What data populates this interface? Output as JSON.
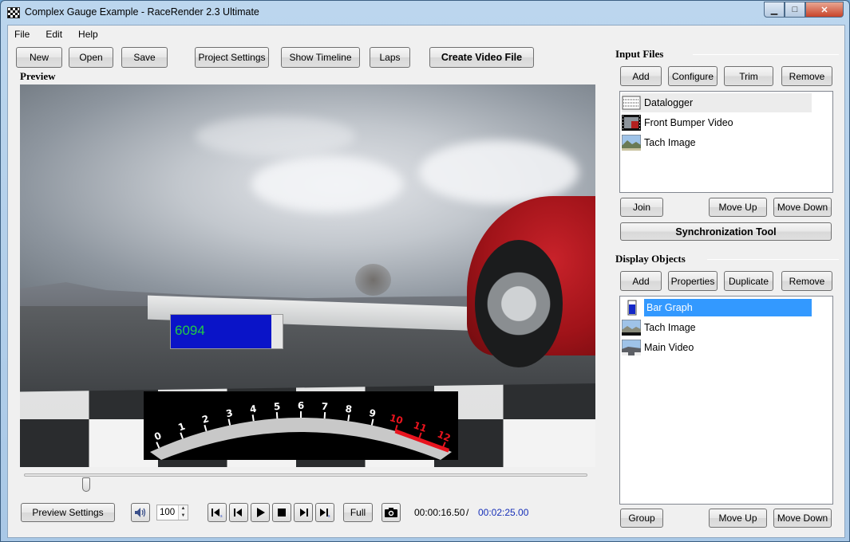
{
  "window": {
    "title": "Complex Gauge Example - RaceRender 2.3 Ultimate",
    "minimize_glyph": "▁",
    "maximize_glyph": "□",
    "close_glyph": "✕"
  },
  "menu": [
    "File",
    "Edit",
    "Help"
  ],
  "toolbar": {
    "new": "New",
    "open": "Open",
    "save": "Save",
    "project_settings": "Project Settings",
    "show_timeline": "Show Timeline",
    "laps": "Laps",
    "create_video": "Create Video File"
  },
  "preview": {
    "label": "Preview",
    "bar_graph_value": "6094",
    "bar_graph_fill_fraction": 0.9,
    "tach_labels": [
      "0",
      "1",
      "2",
      "3",
      "4",
      "5",
      "6",
      "7",
      "8",
      "9",
      "10",
      "11",
      "12"
    ],
    "tach_redline_from": 10,
    "colors": {
      "bar_fill": "#0a14c8",
      "bar_text": "#22cc44",
      "redline": "#e8141e"
    }
  },
  "playback": {
    "preview_settings": "Preview Settings",
    "volume_icon": "speaker-icon",
    "volume_value": "100",
    "full": "Full",
    "current_time": "00:00:16.50",
    "separator": "/",
    "total_time": "00:02:25.00",
    "seek_fraction": 0.11
  },
  "input_files": {
    "label": "Input Files",
    "buttons": {
      "add": "Add",
      "configure": "Configure",
      "trim": "Trim",
      "remove": "Remove"
    },
    "items": [
      {
        "label": "Datalogger",
        "icon": "datalogger-icon"
      },
      {
        "label": "Front Bumper Video",
        "icon": "video-file-icon"
      },
      {
        "label": "Tach Image",
        "icon": "image-file-icon"
      }
    ],
    "join": "Join",
    "move_up": "Move Up",
    "move_down": "Move Down",
    "sync_tool": "Synchronization Tool"
  },
  "display_objects": {
    "label": "Display Objects",
    "buttons": {
      "add": "Add",
      "properties": "Properties",
      "duplicate": "Duplicate",
      "remove": "Remove"
    },
    "items": [
      {
        "label": "Bar Graph",
        "icon": "bar-graph-icon"
      },
      {
        "label": "Tach Image",
        "icon": "image-object-icon"
      },
      {
        "label": "Main Video",
        "icon": "video-object-icon"
      }
    ],
    "group": "Group",
    "move_up": "Move Up",
    "move_down": "Move Down"
  }
}
